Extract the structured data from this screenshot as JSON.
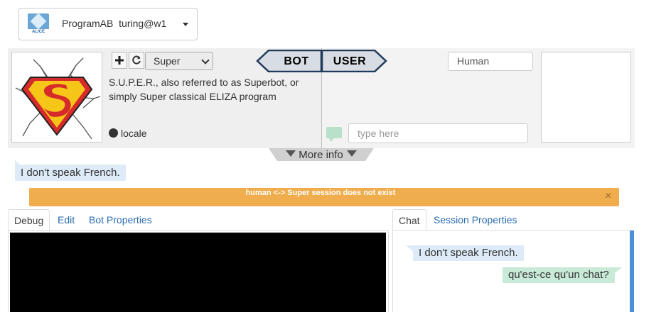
{
  "bot_selector": {
    "logo_text": "ALICE",
    "label": "ProgramAB  turing@w1"
  },
  "header": {
    "bot_select_value": "Super",
    "bot_description": "S.U.P.E.R., also referred to as Superbot, or simply Super classical ELIZA program",
    "locale_label": "locale",
    "bot_tag": "BOT",
    "user_tag": "USER",
    "user_name_value": "Human",
    "chat_input_placeholder": "type here",
    "more_info_label": "More info"
  },
  "last_response": "I don't speak French.",
  "alert": {
    "text": "human <-> Super session does not exist",
    "close": "×"
  },
  "left_tabs": [
    {
      "label": "Debug",
      "active": true
    },
    {
      "label": "Edit",
      "active": false
    },
    {
      "label": "Bot Properties",
      "active": false
    }
  ],
  "right_tabs": [
    {
      "label": "Chat",
      "active": true
    },
    {
      "label": "Session Properties",
      "active": false
    }
  ],
  "chat_messages": [
    {
      "from": "bot",
      "text": "I don't speak French."
    },
    {
      "from": "user",
      "text": "qu'est-ce qu'un chat?"
    }
  ],
  "colors": {
    "alert": "#f0ad4e",
    "bot_bubble": "#dcebf7",
    "user_bubble": "#c9ead7",
    "link": "#2a6db0",
    "tag_border": "#1f3a5a"
  },
  "icons": {
    "add": "plus-icon",
    "refresh": "refresh-icon",
    "locale": "globe-icon",
    "chat": "chat-bubble-icon",
    "more_info": "triangle-down-icon",
    "dropdown": "chevron-down-icon"
  }
}
